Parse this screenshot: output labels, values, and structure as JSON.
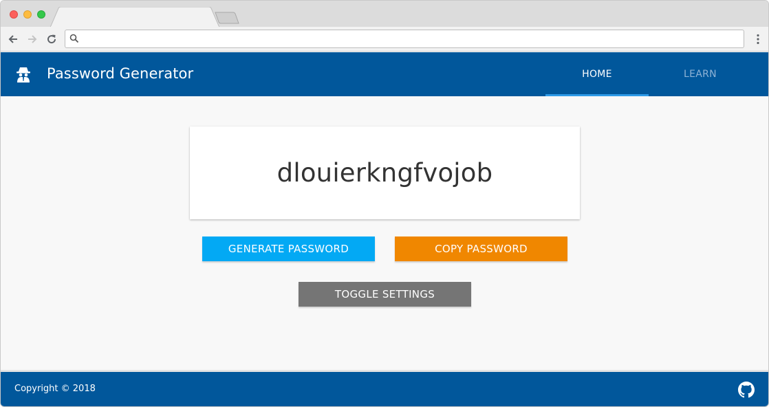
{
  "browser": {
    "address_value": "",
    "address_placeholder": ""
  },
  "header": {
    "logo_icon": "spy-agent-icon",
    "title": "Password Generator",
    "tabs": [
      {
        "label": "HOME",
        "active": true
      },
      {
        "label": "LEARN",
        "active": false
      }
    ]
  },
  "main": {
    "password": "dlouierkngfvojob",
    "buttons": {
      "generate": "GENERATE PASSWORD",
      "copy": "COPY PASSWORD",
      "toggle": "TOGGLE SETTINGS"
    }
  },
  "footer": {
    "copyright": "Copyright © 2018",
    "github_icon": "github-icon"
  },
  "colors": {
    "primary": "#01579b",
    "generate": "#03a9f4",
    "copy": "#f08700",
    "toggle": "#757575",
    "tab_indicator": "#2f9be8"
  }
}
